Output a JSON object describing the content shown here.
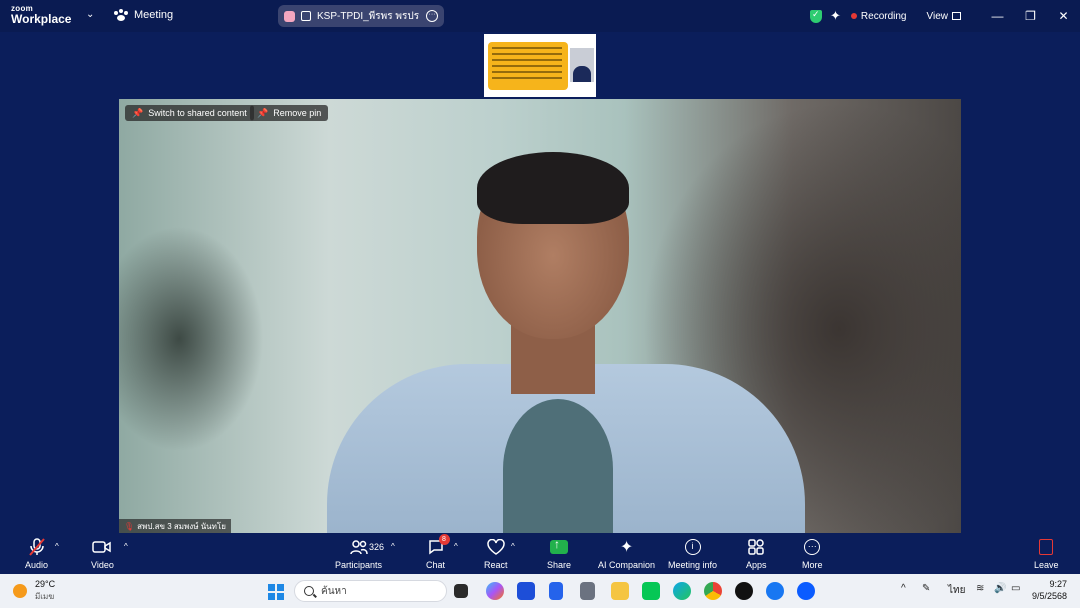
{
  "titlebar": {
    "logo_line1": "zoom",
    "logo_line2": "Workplace",
    "meeting_label": "Meeting",
    "shared_title": "KSP-TPDI_พีรพร พรประสิทธิ์'s",
    "recording_label": "Recording",
    "view_label": "View"
  },
  "video": {
    "switch_label": "Switch to shared content",
    "remove_pin_label": "Remove pin",
    "participant_name": "สพป.สข 3 สมพงษ์ นันทโย"
  },
  "toolbar": {
    "audio": "Audio",
    "video": "Video",
    "participants": "Participants",
    "participants_count": "326",
    "chat": "Chat",
    "chat_badge": "8",
    "react": "React",
    "share": "Share",
    "ai_companion": "AI Companion",
    "meeting_info": "Meeting info",
    "apps": "Apps",
    "more": "More",
    "leave": "Leave"
  },
  "taskbar": {
    "temperature": "29°C",
    "weather_text": "มีเมฆ",
    "search_placeholder": "ค้นหา",
    "language": "ไทย",
    "time": "9:27",
    "date": "9/5/2568"
  },
  "colors": {
    "background": "#0b1e5b",
    "recording": "#e53935",
    "share": "#22b14c",
    "security": "#2ecc71"
  }
}
